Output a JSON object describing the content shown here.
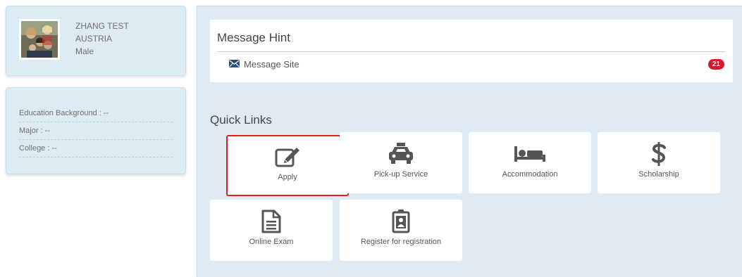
{
  "profile": {
    "name": "ZHANG TEST",
    "country": "AUSTRIA",
    "gender": "Male"
  },
  "education": {
    "background": "Education Background : --",
    "major": "Major : --",
    "college": "College : --"
  },
  "message_hint": {
    "title": "Message Hint",
    "site_label": "Message Site",
    "count": "21"
  },
  "quick_links": {
    "title": "Quick Links",
    "items": [
      {
        "label": "Apply",
        "icon": "edit-icon"
      },
      {
        "label": "Pick-up Service",
        "icon": "taxi-icon"
      },
      {
        "label": "Accommodation",
        "icon": "bed-icon"
      },
      {
        "label": "Scholarship",
        "icon": "dollar-icon"
      },
      {
        "label": "Online Exam",
        "icon": "document-icon"
      },
      {
        "label": "Register for registration",
        "icon": "id-badge-icon"
      }
    ]
  },
  "colors": {
    "panel_bg": "#deeaf4",
    "badge": "#d9182d",
    "highlight_border": "#e02020",
    "icon": "#555555"
  }
}
